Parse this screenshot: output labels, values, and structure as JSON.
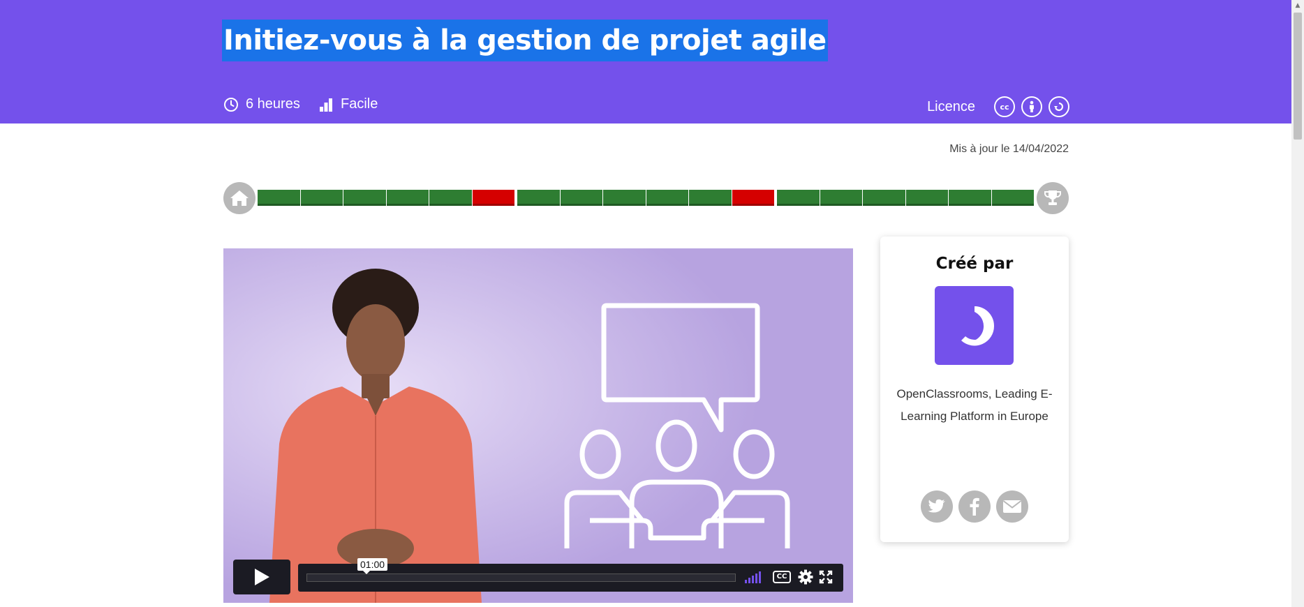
{
  "header": {
    "title": "Initiez-vous à la gestion de projet agile",
    "duration": "6 heures",
    "level": "Facile",
    "licence_label": "Licence",
    "licence_icons": [
      "cc-icon",
      "attribution-icon",
      "share-alike-icon"
    ],
    "licence_cc_text": "cc",
    "background_color": "#7451eb",
    "title_highlight_color": "#1a73e8"
  },
  "updated": "Mis à jour le 14/04/2022",
  "progress": {
    "start_icon": "home-icon",
    "end_icon": "trophy-icon",
    "parts": [
      [
        "pass",
        "pass",
        "pass",
        "pass",
        "pass",
        "fail"
      ],
      [
        "pass",
        "pass",
        "pass",
        "pass",
        "pass",
        "fail"
      ],
      [
        "pass",
        "pass",
        "pass",
        "pass",
        "pass",
        "pass"
      ]
    ],
    "pass_color": "#2e7d32",
    "fail_color": "#d50000"
  },
  "video": {
    "current_time": "01:00",
    "cc_label": "CC",
    "play_icon": "play-icon",
    "volume_icon": "volume-bars-icon",
    "settings_icon": "gear-icon",
    "fullscreen_icon": "fullscreen-icon"
  },
  "sidebar": {
    "title": "Créé par",
    "logo_icon": "openclassrooms-logo",
    "author": "OpenClassrooms, Leading E-Learning Platform in Europe",
    "social": [
      "twitter-icon",
      "facebook-icon",
      "mail-icon"
    ]
  }
}
